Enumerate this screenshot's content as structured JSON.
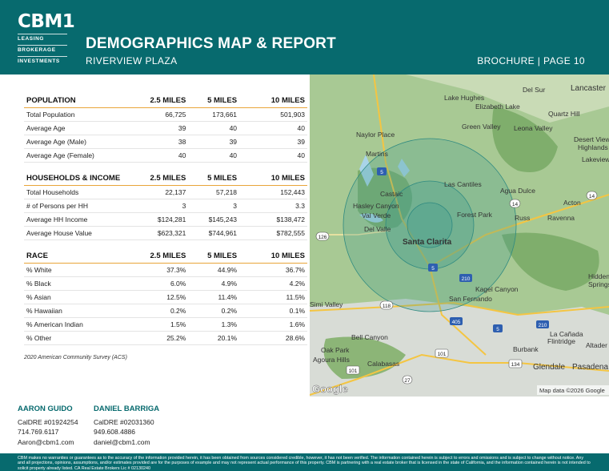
{
  "brand": {
    "logo": "CBM1",
    "lines": [
      "LEASING",
      "BROKERAGE",
      "INVESTMENTS"
    ]
  },
  "header": {
    "title": "DEMOGRAPHICS MAP & REPORT",
    "subtitle": "RIVERVIEW PLAZA",
    "page": "BROCHURE | PAGE 10"
  },
  "tables": [
    {
      "columns": [
        "POPULATION",
        "2.5 MILES",
        "5 MILES",
        "10 MILES"
      ],
      "rows": [
        [
          "Total Population",
          "66,725",
          "173,661",
          "501,903"
        ],
        [
          "Average Age",
          "39",
          "40",
          "40"
        ],
        [
          "Average Age (Male)",
          "38",
          "39",
          "39"
        ],
        [
          "Average Age (Female)",
          "40",
          "40",
          "40"
        ]
      ]
    },
    {
      "columns": [
        "HOUSEHOLDS & INCOME",
        "2.5 MILES",
        "5 MILES",
        "10 MILES"
      ],
      "rows": [
        [
          "Total Households",
          "22,137",
          "57,218",
          "152,443"
        ],
        [
          "# of Persons per HH",
          "3",
          "3",
          "3.3"
        ],
        [
          "Average HH Income",
          "$124,281",
          "$145,243",
          "$138,472"
        ],
        [
          "Average House Value",
          "$623,321",
          "$744,961",
          "$782,555"
        ]
      ]
    },
    {
      "columns": [
        "RACE",
        "2.5 MILES",
        "5 MILES",
        "10 MILES"
      ],
      "rows": [
        [
          "% White",
          "37.3%",
          "44.9%",
          "36.7%"
        ],
        [
          "% Black",
          "6.0%",
          "4.9%",
          "4.2%"
        ],
        [
          "% Asian",
          "12.5%",
          "11.4%",
          "11.5%"
        ],
        [
          "% Hawaiian",
          "0.2%",
          "0.2%",
          "0.1%"
        ],
        [
          "% American Indian",
          "1.5%",
          "1.3%",
          "1.6%"
        ],
        [
          "% Other",
          "25.2%",
          "20.1%",
          "28.6%"
        ]
      ]
    }
  ],
  "source_note": "2020 American Community Survey (ACS)",
  "map": {
    "labels": {
      "del_sur": "Del Sur",
      "lancaster": "Lancaster",
      "lake_hughes": "Lake Hughes",
      "elizabeth_lake": "Elizabeth Lake",
      "quartz_hill": "Quartz Hill",
      "green_valley": "Green Valley",
      "leona_valley": "Leona Valley",
      "naylor_place": "Naylor Place",
      "desert_view": "Desert View",
      "highlands": "Highlands",
      "martins": "Martins",
      "lakeview": "Lakeview",
      "las_cantiles": "Las Cantiles",
      "agua_dulce": "Agua Dulce",
      "castaic": "Castaic",
      "acton": "Acton",
      "hasley_canyon": "Hasley Canyon",
      "val_verde": "Val Verde",
      "forest_park": "Forest Park",
      "russ": "Russ",
      "ravenna": "Ravenna",
      "del_valle": "Del Valle",
      "santa_clarita": "Santa Clarita",
      "hidden": "Hidden",
      "springs": "Springs",
      "kagel_canyon": "Kagel Canyon",
      "san_fernando": "San Fernando",
      "simi_valley": "Simi Valley",
      "bell_canyon": "Bell Canyon",
      "la_canada": "La Cañada",
      "flintridge": "Flintridge",
      "altadena": "Altader",
      "oak_park": "Oak Park",
      "agoura_hills": "Agoura Hills",
      "burbank": "Burbank",
      "calabasas": "Calabasas",
      "glendale": "Glendale",
      "pasadena": "Pasadena"
    },
    "shields": {
      "s5a": "5",
      "s14a": "14",
      "s14b": "14",
      "s126": "126",
      "s5b": "5",
      "s210a": "210",
      "s118": "118",
      "s405": "405",
      "s5c": "5",
      "s210b": "210",
      "s101": "101",
      "s134": "134",
      "s101b": "101",
      "s27": "27"
    },
    "google": "Google",
    "attribution": "Map data ©2026 Google",
    "colors": {
      "terrain": "#8fb97c",
      "water": "#a9d4e8",
      "rings": "#3f9a8f"
    }
  },
  "contacts": [
    {
      "name": "AARON GUIDO",
      "license": "CalDRE #01924254",
      "phone": "714.769.6117",
      "email": "Aaron@cbm1.com"
    },
    {
      "name": "DANIEL BARRIGA",
      "license": "CalDRE #02031360",
      "phone": "949.608.4886",
      "email": "daniel@cbm1.com"
    }
  ],
  "disclaimer": "CBM makes no warranties or guarantees as to the accuracy of the information provided herein, it has been obtained from sources considered credible, however, it has not been verified. The information contained herein is subject to errors and omissions and is subject to change without notice. Any and all projections, opinions, assumptions, and/or estimates provided are for the purposes of example and may not represent actual performance of this property. CBM is partnering with a real estate broker that is licensed in the state of California, and the information contained herein is not intended to solicit property already listed. CA Real Estate Brokers Lic # 02130240",
  "colors": {
    "teal": "#076a6e",
    "accent": "#e9a53a"
  }
}
